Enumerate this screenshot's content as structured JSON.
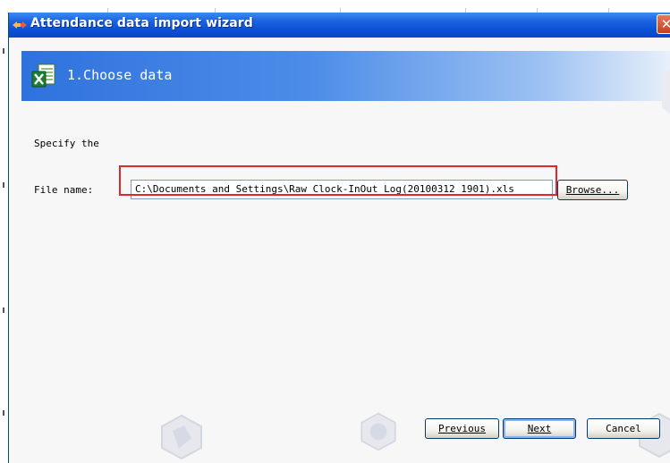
{
  "background": {
    "colors": {
      "edge": "#d6d6d6"
    }
  },
  "window": {
    "title": "Attendance data import wizard",
    "title_icon": "wizard-arrows-icon",
    "close_glyph": "✕"
  },
  "step": {
    "title": "1.Choose data",
    "icon": "excel-file-icon"
  },
  "form": {
    "specify_label": "Specify the",
    "file_name_label": "File name:",
    "file_path_value": "C:\\Documents and Settings\\Raw Clock-InOut Log(20100312_1901).xls",
    "browse_label": "Browse..."
  },
  "buttons": {
    "previous_label": "Previous",
    "next_label": "Next",
    "cancel_label": "Cancel"
  },
  "colors": {
    "titlebar": "#0a50d6",
    "banner": "#2f72dd",
    "highlight": "#e0282a"
  }
}
